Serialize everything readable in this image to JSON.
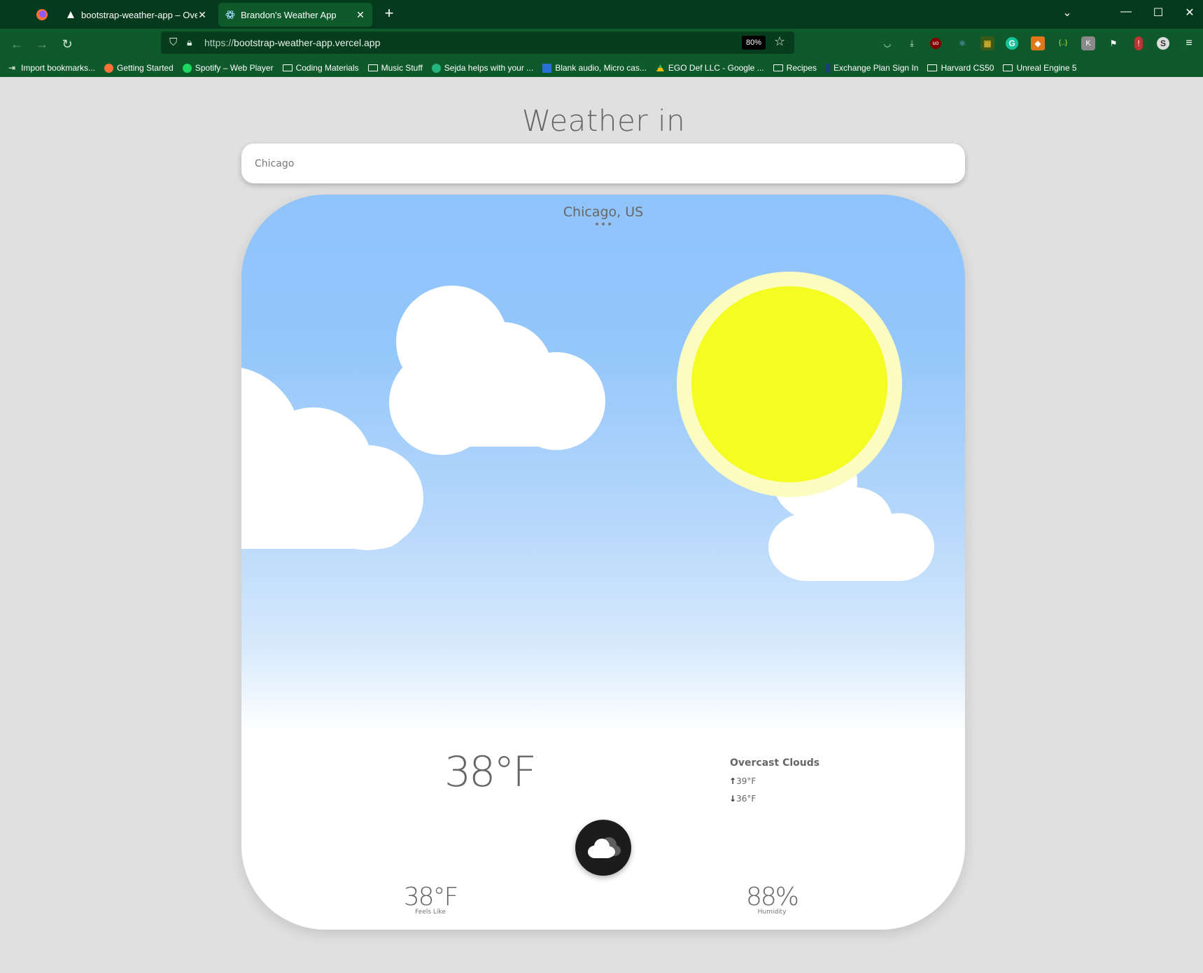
{
  "browser": {
    "tabs": [
      {
        "title": "bootstrap-weather-app – Overvi",
        "active": false
      },
      {
        "title": "Brandon's Weather App",
        "active": true
      }
    ],
    "url_protocol": "https://",
    "url_host": "bootstrap-weather-app.vercel.app",
    "zoom": "80%",
    "bookmarks": [
      {
        "label": "Import bookmarks...",
        "icon": "import-icon"
      },
      {
        "label": "Getting Started",
        "icon": "firefox-icon"
      },
      {
        "label": "Spotify – Web Player",
        "icon": "spotify-icon"
      },
      {
        "label": "Coding Materials",
        "icon": "folder-icon"
      },
      {
        "label": "Music Stuff",
        "icon": "folder-icon"
      },
      {
        "label": "Sejda helps with your ...",
        "icon": "sejda-icon"
      },
      {
        "label": "Blank audio, Micro cas...",
        "icon": "audio-icon"
      },
      {
        "label": "EGO Def LLC - Google ...",
        "icon": "drive-icon"
      },
      {
        "label": "Recipes",
        "icon": "folder-icon"
      },
      {
        "label": "Exchange Plan Sign In",
        "icon": "exchange-icon"
      },
      {
        "label": "Harvard CS50",
        "icon": "folder-icon"
      },
      {
        "label": "Unreal Engine 5",
        "icon": "folder-icon"
      }
    ]
  },
  "app": {
    "heading": "Weather in",
    "search_value": "Chicago",
    "location": "Chicago, US",
    "temperature": "38°F",
    "condition": "Overcast Clouds",
    "high": "39°F",
    "low": "36°F",
    "feels_like": {
      "value": "38°F",
      "label": "Feels Like"
    },
    "humidity": {
      "value": "88%",
      "label": "Humidity"
    }
  },
  "colors": {
    "sky_top": "#8fc4fb",
    "sun": "#f5fc22",
    "sun_halo": "#fcfbc0",
    "browser_chrome": "#0e5a2b",
    "tab_strip": "#053a1c"
  }
}
